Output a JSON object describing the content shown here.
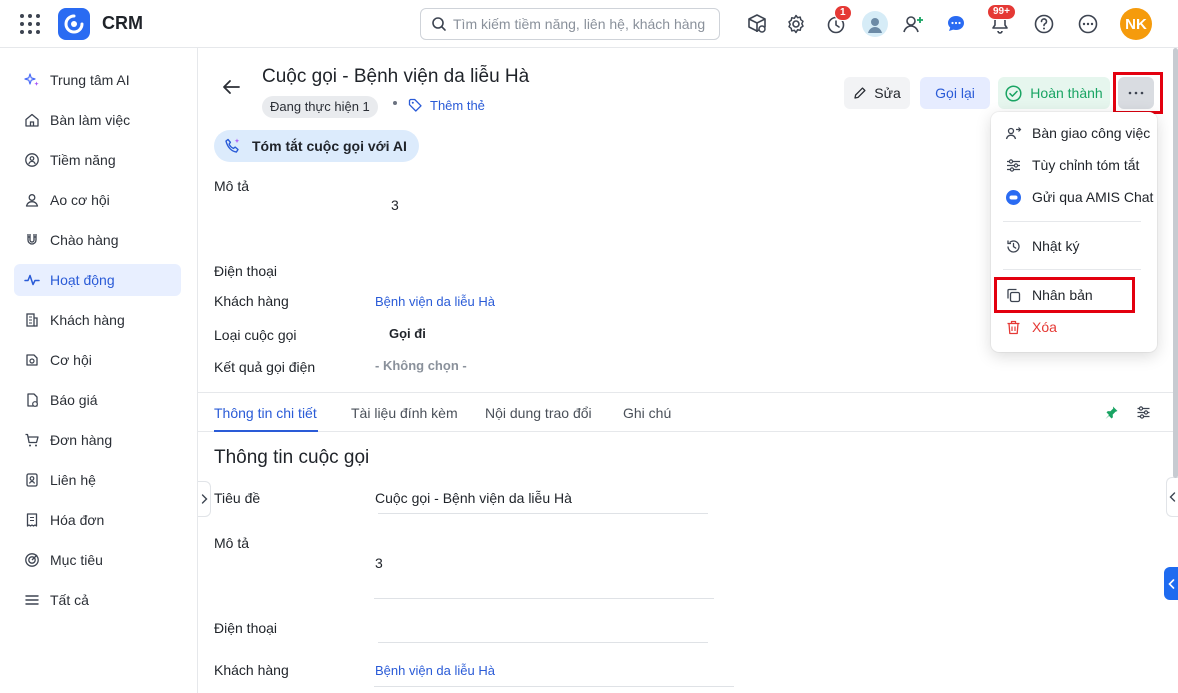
{
  "app": {
    "title": "CRM"
  },
  "search": {
    "placeholder": "Tìm kiếm tiềm năng, liên hệ, khách hàng"
  },
  "header": {
    "reminder_badge": "1",
    "notification_badge": "99+",
    "user_initials": "NK"
  },
  "sidebar": {
    "items": [
      {
        "label": "Trung tâm AI",
        "icon": "sparkle-icon"
      },
      {
        "label": "Bàn làm việc",
        "icon": "home-icon"
      },
      {
        "label": "Tiềm năng",
        "icon": "lead-icon"
      },
      {
        "label": "Ao cơ hội",
        "icon": "users-pool-icon"
      },
      {
        "label": "Chào hàng",
        "icon": "magnet-icon"
      },
      {
        "label": "Hoạt động",
        "icon": "activity-icon",
        "active": true
      },
      {
        "label": "Khách hàng",
        "icon": "building-icon"
      },
      {
        "label": "Cơ hội",
        "icon": "opportunity-icon"
      },
      {
        "label": "Báo giá",
        "icon": "quote-icon"
      },
      {
        "label": "Đơn hàng",
        "icon": "cart-icon"
      },
      {
        "label": "Liên hệ",
        "icon": "contact-icon"
      },
      {
        "label": "Hóa đơn",
        "icon": "invoice-icon"
      },
      {
        "label": "Mục tiêu",
        "icon": "target-icon"
      },
      {
        "label": "Tất cả",
        "icon": "menu-icon"
      }
    ]
  },
  "record": {
    "title": "Cuộc gọi - Bệnh viện da liễu Hà",
    "status": "Đang thực hiện 1",
    "add_tag": "Thêm thẻ"
  },
  "actions": {
    "edit": "Sửa",
    "callback": "Gọi lại",
    "complete": "Hoàn thành"
  },
  "ai_summary": {
    "label": "Tóm tắt cuộc gọi với AI"
  },
  "summary_fields": [
    {
      "label": "Mô tả",
      "value": "3"
    },
    {
      "label": "Điện thoại",
      "value": ""
    },
    {
      "label": "Khách hàng",
      "value": "Bệnh viện da liễu Hà"
    },
    {
      "label": "Loại cuộc gọi",
      "value": "Gọi đi"
    },
    {
      "label": "Kết quả gọi điện",
      "value": "- Không chọn -"
    }
  ],
  "tabs": [
    {
      "label": "Thông tin chi tiết",
      "active": true
    },
    {
      "label": "Tài liệu đính kèm"
    },
    {
      "label": "Nội dung trao đổi"
    },
    {
      "label": "Ghi chú"
    }
  ],
  "detail": {
    "section_title": "Thông tin cuộc gọi",
    "fields": [
      {
        "label": "Tiêu đề",
        "value": "Cuộc gọi - Bệnh viện da liễu Hà"
      },
      {
        "label": "Mô tả",
        "value": "3"
      },
      {
        "label": "Điện thoại",
        "value": ""
      },
      {
        "label": "Khách hàng",
        "value": "Bệnh viện da liễu Hà"
      }
    ]
  },
  "more_menu": {
    "items": [
      {
        "label": "Bàn giao công việc",
        "icon": "handover-icon"
      },
      {
        "label": "Tùy chỉnh tóm tắt",
        "icon": "sliders-icon"
      },
      {
        "label": "Gửi qua AMIS Chat",
        "icon": "chat-icon"
      },
      {
        "label": "Nhật ký",
        "icon": "history-icon"
      },
      {
        "label": "Nhân bản",
        "icon": "copy-icon"
      },
      {
        "label": "Xóa",
        "icon": "trash-icon"
      }
    ]
  },
  "colors": {
    "accent": "#2a5bd7",
    "success": "#19a463",
    "danger": "#e53935",
    "highlight": "#e3000f",
    "avatar": "#f59b0c"
  }
}
